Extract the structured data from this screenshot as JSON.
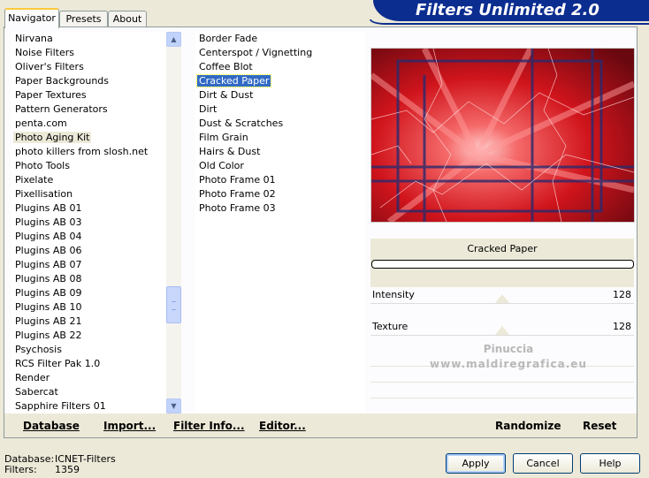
{
  "tabs": [
    {
      "label": "Navigator"
    },
    {
      "label": "Presets"
    },
    {
      "label": "About"
    }
  ],
  "banner": {
    "title": "Filters Unlimited 2.0"
  },
  "categories": {
    "items": [
      "Nirvana",
      "Noise Filters",
      "Oliver's Filters",
      "Paper Backgrounds",
      "Paper Textures",
      "Pattern Generators",
      "penta.com",
      "Photo Aging Kit",
      "photo killers from slosh.net",
      "Photo Tools",
      "Pixelate",
      "Pixellisation",
      "Plugins AB 01",
      "Plugins AB 03",
      "Plugins AB 04",
      "Plugins AB 06",
      "Plugins AB 07",
      "Plugins AB 08",
      "Plugins AB 09",
      "Plugins AB 10",
      "Plugins AB 21",
      "Plugins AB 22",
      "Psychosis",
      "RCS Filter Pak 1.0",
      "Render",
      "Sabercat",
      "Sapphire Filters 01"
    ],
    "selected": "Photo Aging Kit"
  },
  "filters": {
    "items": [
      "Border Fade",
      "Centerspot / Vignetting",
      "Coffee Blot",
      "Cracked Paper",
      "Dirt & Dust",
      "Dirt",
      "Dust & Scratches",
      "Film Grain",
      "Hairs & Dust",
      "Old Color",
      "Photo Frame 01",
      "Photo Frame 02",
      "Photo Frame 03"
    ],
    "selected": "Cracked Paper"
  },
  "preview": {
    "filter_name": "Cracked Paper",
    "watermark_line1": "Pinuccia",
    "watermark_line2": "www.maldiregrafica.eu"
  },
  "sliders": [
    {
      "label": "Intensity",
      "value": "128",
      "fraction": 0.5
    },
    {
      "label": "Texture",
      "value": "128",
      "fraction": 0.5
    }
  ],
  "bottom_bar": {
    "database": "Database",
    "import": "Import...",
    "filter_info": "Filter Info...",
    "editor": "Editor...",
    "randomize": "Randomize",
    "reset": "Reset"
  },
  "status": {
    "database_label": "Database:",
    "database_value": "ICNET-Filters",
    "filters_label": "Filters:",
    "filters_value": "1359"
  },
  "dialog_buttons": {
    "apply": "Apply",
    "cancel": "Cancel",
    "help": "Help"
  },
  "colors": {
    "selection": "#316ac5",
    "banner": "#0b2d90",
    "tab_highlight": "#ffc83c"
  }
}
